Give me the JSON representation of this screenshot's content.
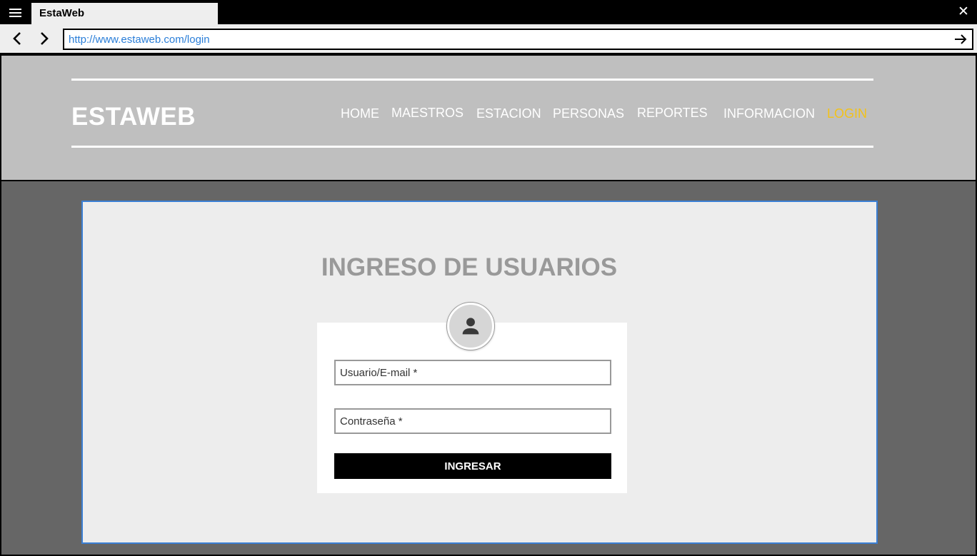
{
  "browser": {
    "tab_title": "EstaWeb",
    "url": "http://www.estaweb.com/login",
    "icons": {
      "menu": "hamburger-menu-icon",
      "close": "close-icon",
      "back": "chevron-left-icon",
      "forward": "chevron-right-icon",
      "go": "arrow-right-icon"
    }
  },
  "header": {
    "logo": "ESTAWEB",
    "nav": [
      {
        "label": "HOME"
      },
      {
        "label": "MAESTROS"
      },
      {
        "label": "ESTACION"
      },
      {
        "label": "PERSONAS"
      },
      {
        "label": "REPORTES"
      },
      {
        "label": "INFORMACION"
      },
      {
        "label": "LOGIN",
        "active": true
      }
    ]
  },
  "login": {
    "title": "INGRESO DE USUARIOS",
    "avatar_icon": "user-icon",
    "username_placeholder": "Usuario/E-mail *",
    "password_placeholder": "Contraseña *",
    "submit_label": "INGRESAR"
  },
  "colors": {
    "url_text": "#2a7ed8",
    "header_bg": "#bfbfbf",
    "body_bg": "#666666",
    "card_bg": "#ededed",
    "card_border": "#3b7fd4",
    "active_nav": "#f2c21a",
    "title_text": "#999999"
  }
}
